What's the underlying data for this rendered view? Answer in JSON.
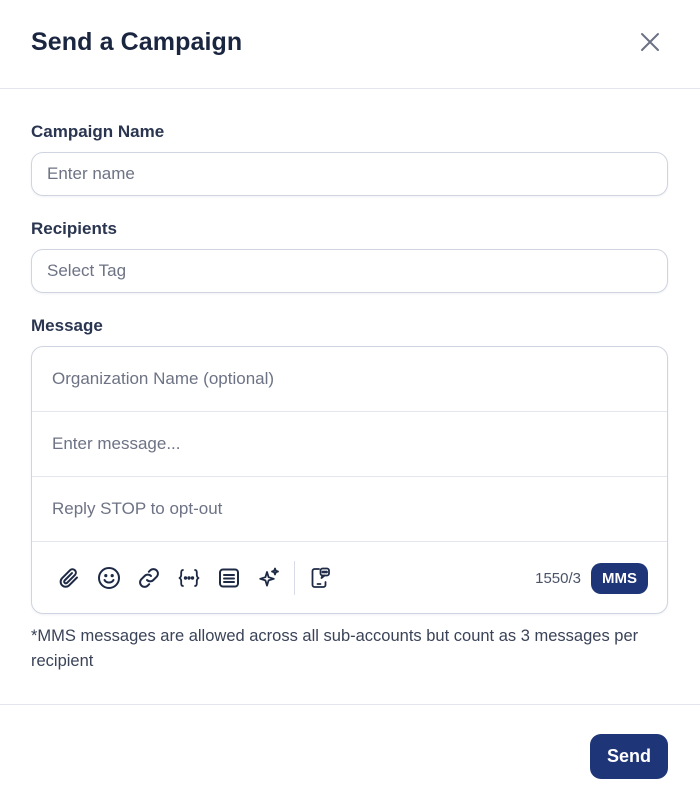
{
  "modal": {
    "title": "Send a Campaign"
  },
  "campaign_name": {
    "label": "Campaign Name",
    "placeholder": "Enter name",
    "value": ""
  },
  "recipients": {
    "label": "Recipients",
    "placeholder": "Select Tag",
    "value": ""
  },
  "message": {
    "label": "Message",
    "org_placeholder": "Organization Name (optional)",
    "body_placeholder": "Enter message...",
    "opt_out_text": "Reply STOP to opt-out",
    "toolbar_icons": [
      "paperclip-icon",
      "emoji-icon",
      "link-icon",
      "variables-icon",
      "template-icon",
      "sparkle-icon",
      "device-message-icon"
    ],
    "counter": "1550/3",
    "type_badge": "MMS"
  },
  "note": "*MMS messages are allowed across all sub-accounts but count as 3 messages per recipient",
  "footer": {
    "send_label": "Send"
  },
  "colors": {
    "primary": "#1e3577",
    "text": "#1a2540",
    "muted": "#6d7385",
    "border": "#cfd4e0"
  }
}
